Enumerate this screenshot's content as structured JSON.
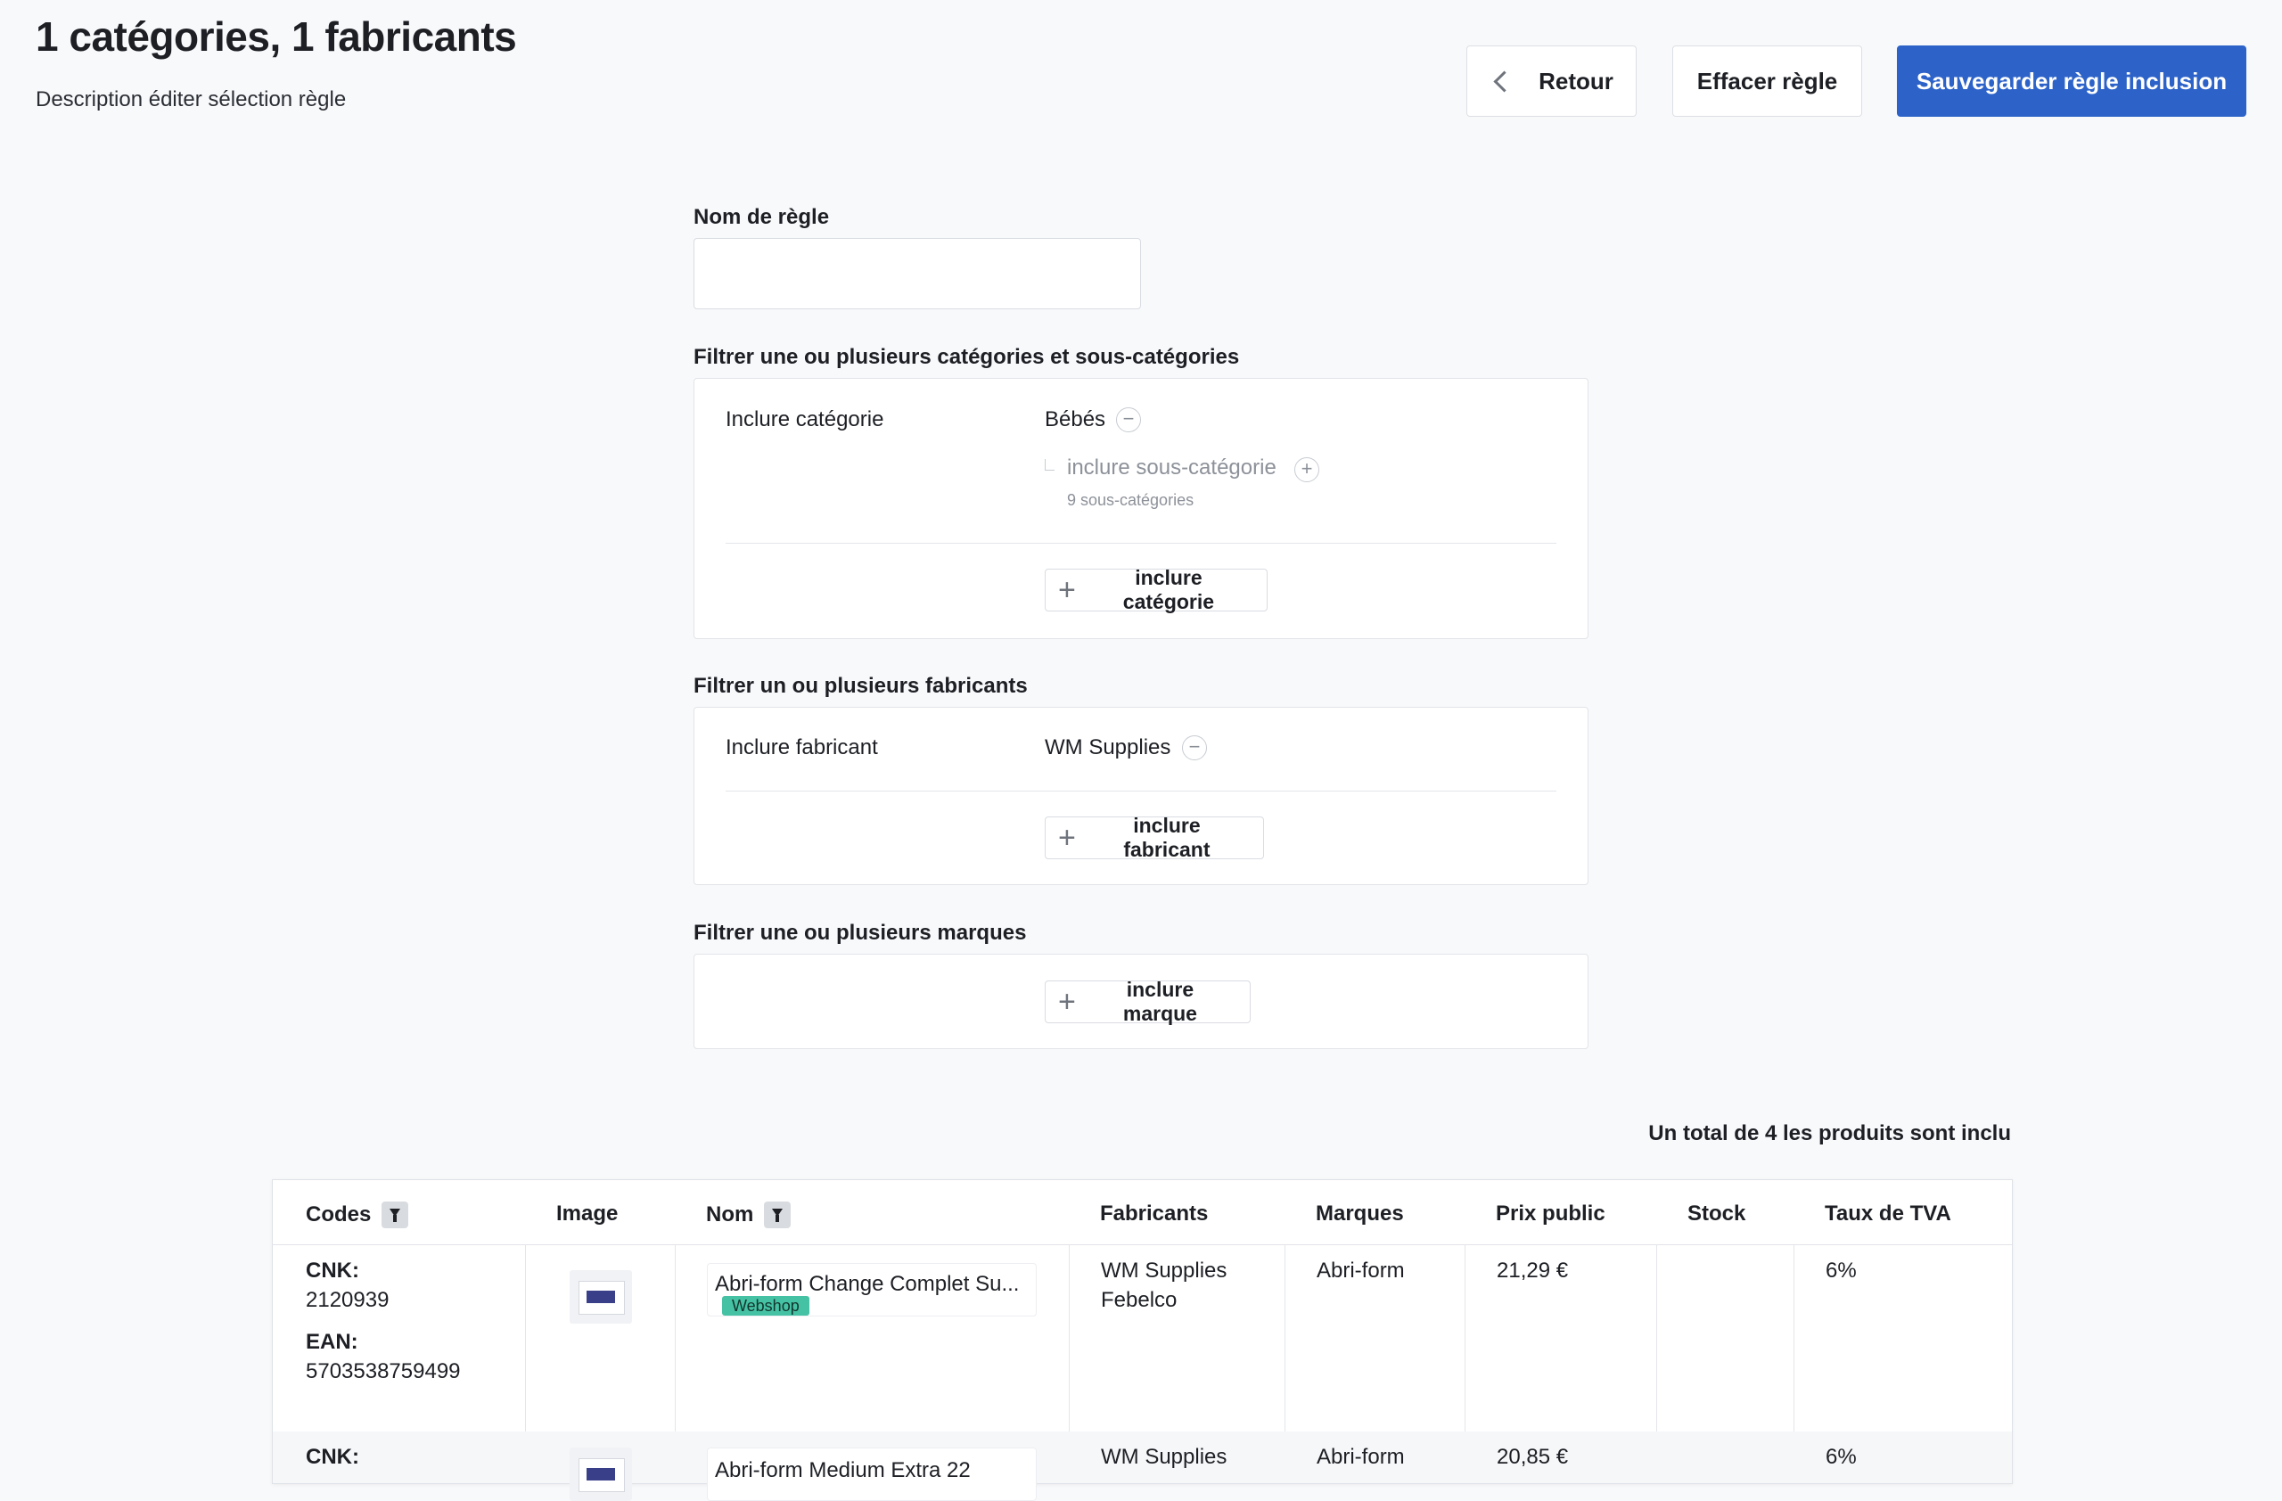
{
  "header": {
    "title": "1 catégories, 1 fabricants",
    "description": "Description éditer sélection règle",
    "back_label": "Retour",
    "clear_label": "Effacer règle",
    "save_label": "Sauvegarder règle inclusion",
    "primary_color": "#2d63c8"
  },
  "rule_name": {
    "label": "Nom de règle",
    "value": ""
  },
  "categories": {
    "label": "Filtrer une ou plusieurs catégories et sous-catégories",
    "row_label": "Inclure catégorie",
    "selected": "Bébés",
    "remove_icon": "minus-circle-icon",
    "subcategory_placeholder": "inclure sous-catégorie",
    "subcategory_count": "9 sous-catégories",
    "add_icon": "plus-circle-icon",
    "add_button": "inclure catégorie"
  },
  "manufacturers": {
    "label": "Filtrer un ou plusieurs fabricants",
    "row_label": "Inclure fabricant",
    "selected": "WM Supplies",
    "add_button": "inclure fabricant"
  },
  "brands": {
    "label": "Filtrer une ou plusieurs marques",
    "add_button": "inclure marque"
  },
  "summary": {
    "total_text": "Un total de 4 les produits sont inclu"
  },
  "table": {
    "columns": {
      "codes": "Codes",
      "image": "Image",
      "name": "Nom",
      "manufacturers": "Fabricants",
      "brands": "Marques",
      "price": "Prix public",
      "stock": "Stock",
      "vat": "Taux de TVA"
    },
    "rows": [
      {
        "cnk_label": "CNK:",
        "cnk": "2120939",
        "ean_label": "EAN:",
        "ean": "5703538759499",
        "name": "Abri-form Change Complet Su...",
        "badge": "Webshop",
        "manufacturer_1": "WM Supplies",
        "manufacturer_2": "Febelco",
        "brand": "Abri-form",
        "price": "21,29 €",
        "stock": "",
        "vat": "6%"
      },
      {
        "cnk_label": "CNK:",
        "name": "Abri-form Medium Extra 22",
        "manufacturer_1": "WM Supplies",
        "brand": "Abri-form",
        "price": "20,85 €",
        "stock": "",
        "vat": "6%"
      }
    ]
  }
}
